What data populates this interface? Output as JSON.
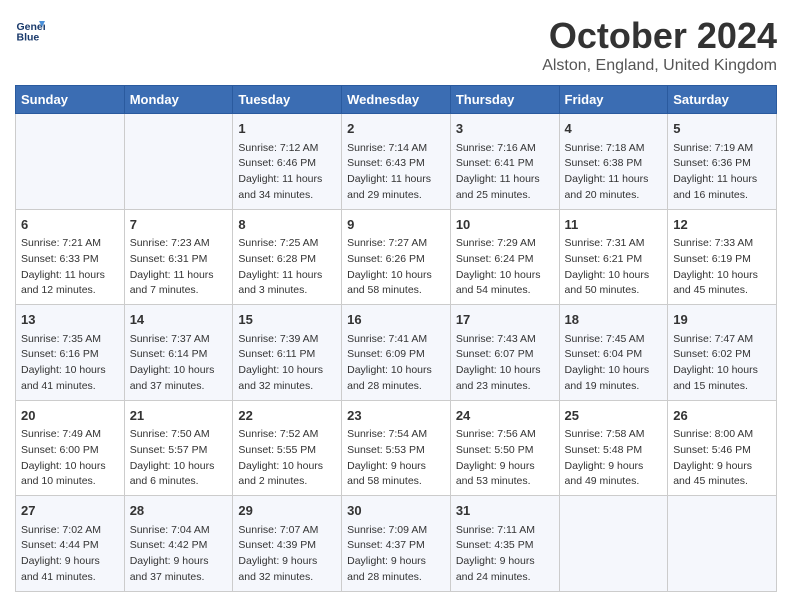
{
  "header": {
    "logo_line1": "General",
    "logo_line2": "Blue",
    "month": "October 2024",
    "location": "Alston, England, United Kingdom"
  },
  "weekdays": [
    "Sunday",
    "Monday",
    "Tuesday",
    "Wednesday",
    "Thursday",
    "Friday",
    "Saturday"
  ],
  "weeks": [
    [
      {
        "day": "",
        "info": ""
      },
      {
        "day": "",
        "info": ""
      },
      {
        "day": "1",
        "info": "Sunrise: 7:12 AM\nSunset: 6:46 PM\nDaylight: 11 hours\nand 34 minutes."
      },
      {
        "day": "2",
        "info": "Sunrise: 7:14 AM\nSunset: 6:43 PM\nDaylight: 11 hours\nand 29 minutes."
      },
      {
        "day": "3",
        "info": "Sunrise: 7:16 AM\nSunset: 6:41 PM\nDaylight: 11 hours\nand 25 minutes."
      },
      {
        "day": "4",
        "info": "Sunrise: 7:18 AM\nSunset: 6:38 PM\nDaylight: 11 hours\nand 20 minutes."
      },
      {
        "day": "5",
        "info": "Sunrise: 7:19 AM\nSunset: 6:36 PM\nDaylight: 11 hours\nand 16 minutes."
      }
    ],
    [
      {
        "day": "6",
        "info": "Sunrise: 7:21 AM\nSunset: 6:33 PM\nDaylight: 11 hours\nand 12 minutes."
      },
      {
        "day": "7",
        "info": "Sunrise: 7:23 AM\nSunset: 6:31 PM\nDaylight: 11 hours\nand 7 minutes."
      },
      {
        "day": "8",
        "info": "Sunrise: 7:25 AM\nSunset: 6:28 PM\nDaylight: 11 hours\nand 3 minutes."
      },
      {
        "day": "9",
        "info": "Sunrise: 7:27 AM\nSunset: 6:26 PM\nDaylight: 10 hours\nand 58 minutes."
      },
      {
        "day": "10",
        "info": "Sunrise: 7:29 AM\nSunset: 6:24 PM\nDaylight: 10 hours\nand 54 minutes."
      },
      {
        "day": "11",
        "info": "Sunrise: 7:31 AM\nSunset: 6:21 PM\nDaylight: 10 hours\nand 50 minutes."
      },
      {
        "day": "12",
        "info": "Sunrise: 7:33 AM\nSunset: 6:19 PM\nDaylight: 10 hours\nand 45 minutes."
      }
    ],
    [
      {
        "day": "13",
        "info": "Sunrise: 7:35 AM\nSunset: 6:16 PM\nDaylight: 10 hours\nand 41 minutes."
      },
      {
        "day": "14",
        "info": "Sunrise: 7:37 AM\nSunset: 6:14 PM\nDaylight: 10 hours\nand 37 minutes."
      },
      {
        "day": "15",
        "info": "Sunrise: 7:39 AM\nSunset: 6:11 PM\nDaylight: 10 hours\nand 32 minutes."
      },
      {
        "day": "16",
        "info": "Sunrise: 7:41 AM\nSunset: 6:09 PM\nDaylight: 10 hours\nand 28 minutes."
      },
      {
        "day": "17",
        "info": "Sunrise: 7:43 AM\nSunset: 6:07 PM\nDaylight: 10 hours\nand 23 minutes."
      },
      {
        "day": "18",
        "info": "Sunrise: 7:45 AM\nSunset: 6:04 PM\nDaylight: 10 hours\nand 19 minutes."
      },
      {
        "day": "19",
        "info": "Sunrise: 7:47 AM\nSunset: 6:02 PM\nDaylight: 10 hours\nand 15 minutes."
      }
    ],
    [
      {
        "day": "20",
        "info": "Sunrise: 7:49 AM\nSunset: 6:00 PM\nDaylight: 10 hours\nand 10 minutes."
      },
      {
        "day": "21",
        "info": "Sunrise: 7:50 AM\nSunset: 5:57 PM\nDaylight: 10 hours\nand 6 minutes."
      },
      {
        "day": "22",
        "info": "Sunrise: 7:52 AM\nSunset: 5:55 PM\nDaylight: 10 hours\nand 2 minutes."
      },
      {
        "day": "23",
        "info": "Sunrise: 7:54 AM\nSunset: 5:53 PM\nDaylight: 9 hours\nand 58 minutes."
      },
      {
        "day": "24",
        "info": "Sunrise: 7:56 AM\nSunset: 5:50 PM\nDaylight: 9 hours\nand 53 minutes."
      },
      {
        "day": "25",
        "info": "Sunrise: 7:58 AM\nSunset: 5:48 PM\nDaylight: 9 hours\nand 49 minutes."
      },
      {
        "day": "26",
        "info": "Sunrise: 8:00 AM\nSunset: 5:46 PM\nDaylight: 9 hours\nand 45 minutes."
      }
    ],
    [
      {
        "day": "27",
        "info": "Sunrise: 7:02 AM\nSunset: 4:44 PM\nDaylight: 9 hours\nand 41 minutes."
      },
      {
        "day": "28",
        "info": "Sunrise: 7:04 AM\nSunset: 4:42 PM\nDaylight: 9 hours\nand 37 minutes."
      },
      {
        "day": "29",
        "info": "Sunrise: 7:07 AM\nSunset: 4:39 PM\nDaylight: 9 hours\nand 32 minutes."
      },
      {
        "day": "30",
        "info": "Sunrise: 7:09 AM\nSunset: 4:37 PM\nDaylight: 9 hours\nand 28 minutes."
      },
      {
        "day": "31",
        "info": "Sunrise: 7:11 AM\nSunset: 4:35 PM\nDaylight: 9 hours\nand 24 minutes."
      },
      {
        "day": "",
        "info": ""
      },
      {
        "day": "",
        "info": ""
      }
    ]
  ]
}
